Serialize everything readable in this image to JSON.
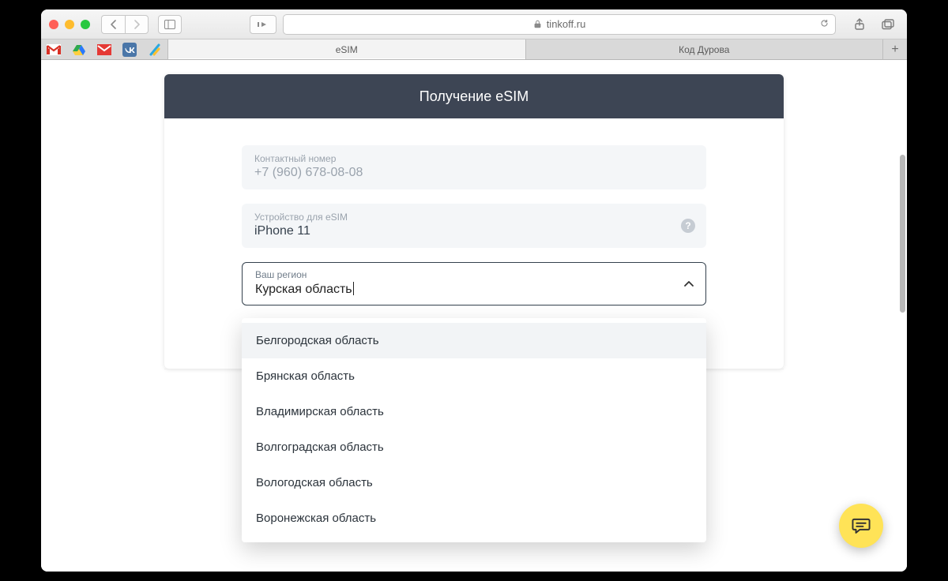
{
  "browser": {
    "url_host": "tinkoff.ru",
    "tabs": [
      "eSIM",
      "Код Дурова"
    ],
    "active_tab": 0
  },
  "card": {
    "title": "Получение eSIM",
    "phone": {
      "label": "Контактный номер",
      "value": "+7 (960) 678-08-08"
    },
    "device": {
      "label": "Устройство для eSIM",
      "value": "iPhone 11"
    },
    "region": {
      "label": "Ваш регион",
      "value": "Курская область"
    }
  },
  "region_options": [
    "Белгородская область",
    "Брянская область",
    "Владимирская область",
    "Волгоградская область",
    "Вологодская область",
    "Воронежская область"
  ]
}
